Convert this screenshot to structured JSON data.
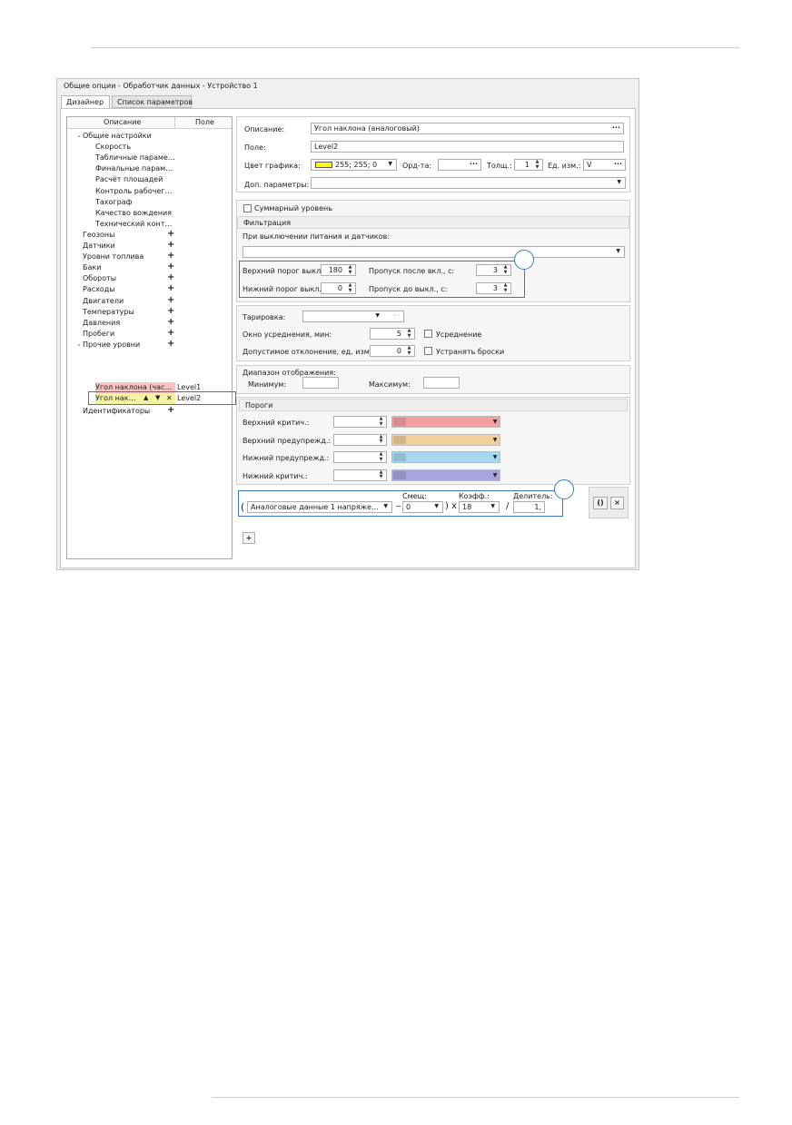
{
  "window": {
    "title": "Общие опции - Обработчик данных - Устройство 1",
    "tabs": [
      "Дизайнер",
      "Список параметров"
    ]
  },
  "tree": {
    "col_description": "Описание",
    "col_field": "Поле",
    "items": [
      {
        "label": "Общие настройки",
        "level": 0,
        "expander": "⌄"
      },
      {
        "label": "Скорость",
        "level": 1
      },
      {
        "label": "Табличные параме…",
        "level": 1
      },
      {
        "label": "Финальные парам…",
        "level": 1
      },
      {
        "label": "Расчёт площадей",
        "level": 1
      },
      {
        "label": "Контроль рабочег…",
        "level": 1
      },
      {
        "label": "Тахограф",
        "level": 1
      },
      {
        "label": "Качество вождения",
        "level": 1
      },
      {
        "label": "Технический конт…",
        "level": 1
      },
      {
        "label": "Геозоны",
        "level": 0,
        "plus": "+"
      },
      {
        "label": "Датчики",
        "level": 0,
        "plus": "+"
      },
      {
        "label": "Уровни топлива",
        "level": 0,
        "plus": "+"
      },
      {
        "label": "Баки",
        "level": 0,
        "plus": "+"
      },
      {
        "label": "Обороты",
        "level": 0,
        "plus": "+"
      },
      {
        "label": "Расходы",
        "level": 0,
        "plus": "+"
      },
      {
        "label": "Двигатели",
        "level": 0,
        "plus": "+"
      },
      {
        "label": "Температуры",
        "level": 0,
        "plus": "+"
      },
      {
        "label": "Давления",
        "level": 0,
        "plus": "+"
      },
      {
        "label": "Пробеги",
        "level": 0,
        "plus": "+"
      },
      {
        "label": "Прочие уровни",
        "level": 0,
        "plus": "+",
        "expander": "⌄"
      }
    ],
    "child1": {
      "label": "Угол наклона (час…",
      "field": "Level1"
    },
    "child2": {
      "label": "Угол нак…",
      "up": "▲",
      "down": "▼",
      "del": "✕",
      "field": "Level2"
    },
    "last": {
      "label": "Идентификаторы",
      "plus": "+"
    }
  },
  "form": {
    "description_label": "Описание:",
    "description_value": "Угол наклона (аналоговый)",
    "field_label": "Поле:",
    "field_value": "Level2",
    "chart_color_label": "Цвет графика:",
    "chart_color_value": "255; 255; 0",
    "chart_color_hex": "#ffff00",
    "ord_label": "Орд-та:",
    "thick_label": "Толщ.:",
    "thick_value": "1",
    "unit_label": "Ед. изм.:",
    "unit_value": "V",
    "extra_label": "Доп. параметры:",
    "sum_level_label": "Суммарный уровень",
    "filter_title": "Фильтрация",
    "power_off_label": "При выключении питания и датчиков:",
    "upper_off_label": "Верхний порог выкл.:",
    "upper_off_value": "180",
    "skip_after_on_label": "Пропуск после вкл., с:",
    "skip_after_on_value": "3",
    "lower_off_label": "Нижний порог выкл.:",
    "lower_off_value": "0",
    "skip_before_off_label": "Пропуск до выкл., с:",
    "skip_before_off_value": "3",
    "calib_label": "Тарировка:",
    "avg_window_label": "Окно усреднения, мин:",
    "avg_window_value": "5",
    "averaging_label": "Усреднение",
    "deviation_label": "Допустимое отклонение, ед. изм.:",
    "deviation_value": "0",
    "remove_spikes_label": "Устранять броски",
    "range_title": "Диапазон отображения:",
    "min_label": "Минимум:",
    "max_label": "Максимум:",
    "thresholds_title": "Пороги",
    "thresholds": [
      {
        "label": "Верхний критич.:",
        "color": "#f4a0a2"
      },
      {
        "label": "Верхний предупрежд.:",
        "color": "#f2d09c"
      },
      {
        "label": "Нижний предупрежд.:",
        "color": "#a8d8f0"
      },
      {
        "label": "Нижний критич.:",
        "color": "#a6a6dc"
      }
    ],
    "formula": {
      "open_paren": "(",
      "source": "Аналоговые данные 1 напряже…",
      "minus": "−",
      "offset_label": "Смещ:",
      "offset_value": "0",
      "close_x": ") x",
      "coef_label": "Коэфф.:",
      "coef_value": "18",
      "slash": "/",
      "divisor_label": "Делитель:",
      "divisor_value": "1,",
      "paren_btn": "()",
      "close_btn": "×"
    },
    "add_btn": "+"
  }
}
